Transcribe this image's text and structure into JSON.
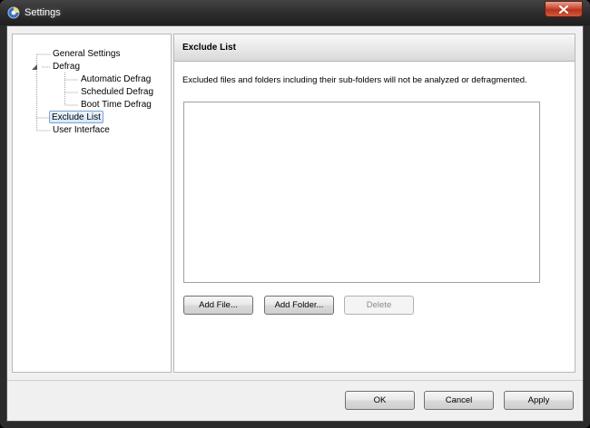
{
  "window": {
    "title": "Settings",
    "app_icon": "defraggler-icon",
    "close_icon": "close-icon"
  },
  "nav": {
    "items": [
      {
        "label": "General Settings",
        "level": 0,
        "selected": false
      },
      {
        "label": "Defrag",
        "level": 0,
        "expanded": true,
        "selected": false
      },
      {
        "label": "Automatic Defrag",
        "level": 1,
        "selected": false
      },
      {
        "label": "Scheduled Defrag",
        "level": 1,
        "selected": false
      },
      {
        "label": "Boot Time Defrag",
        "level": 1,
        "selected": false
      },
      {
        "label": "Exclude List",
        "level": 0,
        "selected": true
      },
      {
        "label": "User Interface",
        "level": 0,
        "selected": false
      }
    ]
  },
  "content": {
    "title": "Exclude List",
    "description": "Excluded files and folders including their sub-folders will not be analyzed or defragmented.",
    "buttons": {
      "add_file": "Add File...",
      "add_folder": "Add Folder...",
      "delete": "Delete"
    }
  },
  "footer": {
    "ok": "OK",
    "cancel": "Cancel",
    "apply": "Apply"
  },
  "colors": {
    "titlebar": "#2e2e2e",
    "close_button": "#c94b32",
    "selection": "#d5e8fb",
    "client_bg": "#f0f0f0"
  }
}
